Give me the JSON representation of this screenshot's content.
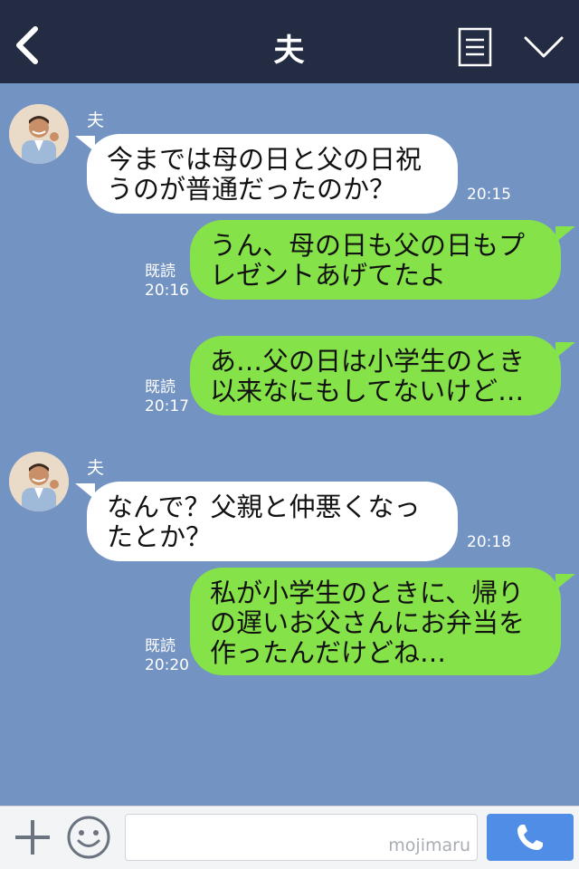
{
  "header": {
    "title": "夫",
    "back_icon": "chevron-left-icon",
    "menu_icon": "list-icon",
    "collapse_icon": "chevron-down-icon"
  },
  "messages": [
    {
      "direction": "in",
      "sender": "夫",
      "lines": [
        "今までは母の日と父の日祝",
        "うのが普通だったのか？"
      ],
      "time": "20:15"
    },
    {
      "direction": "out",
      "read": "既読",
      "lines": [
        "うん、母の日も父の日もプ",
        "レゼントあげてたよ"
      ],
      "time": "20:16"
    },
    {
      "direction": "out",
      "read": "既読",
      "lines": [
        "あ…父の日は小学生のとき",
        "以来なにもしてないけど…"
      ],
      "time": "20:17"
    },
    {
      "direction": "in",
      "sender": "夫",
      "lines": [
        "なんで？父親と仲悪くなっ",
        "たとか？"
      ],
      "time": "20:18"
    },
    {
      "direction": "out",
      "read": "既読",
      "lines": [
        "私が小学生のときに、帰り",
        "の遅いお父さんにお弁当を",
        "作ったんだけどね…"
      ],
      "time": "20:20"
    }
  ],
  "input": {
    "placeholder": "",
    "value": "",
    "watermark": "mojimaru"
  },
  "colors": {
    "header_bg": "#232c42",
    "chat_bg": "#7393c3",
    "incoming_bubble": "#ffffff",
    "outgoing_bubble": "#85e249",
    "call_button": "#4f8de6"
  }
}
